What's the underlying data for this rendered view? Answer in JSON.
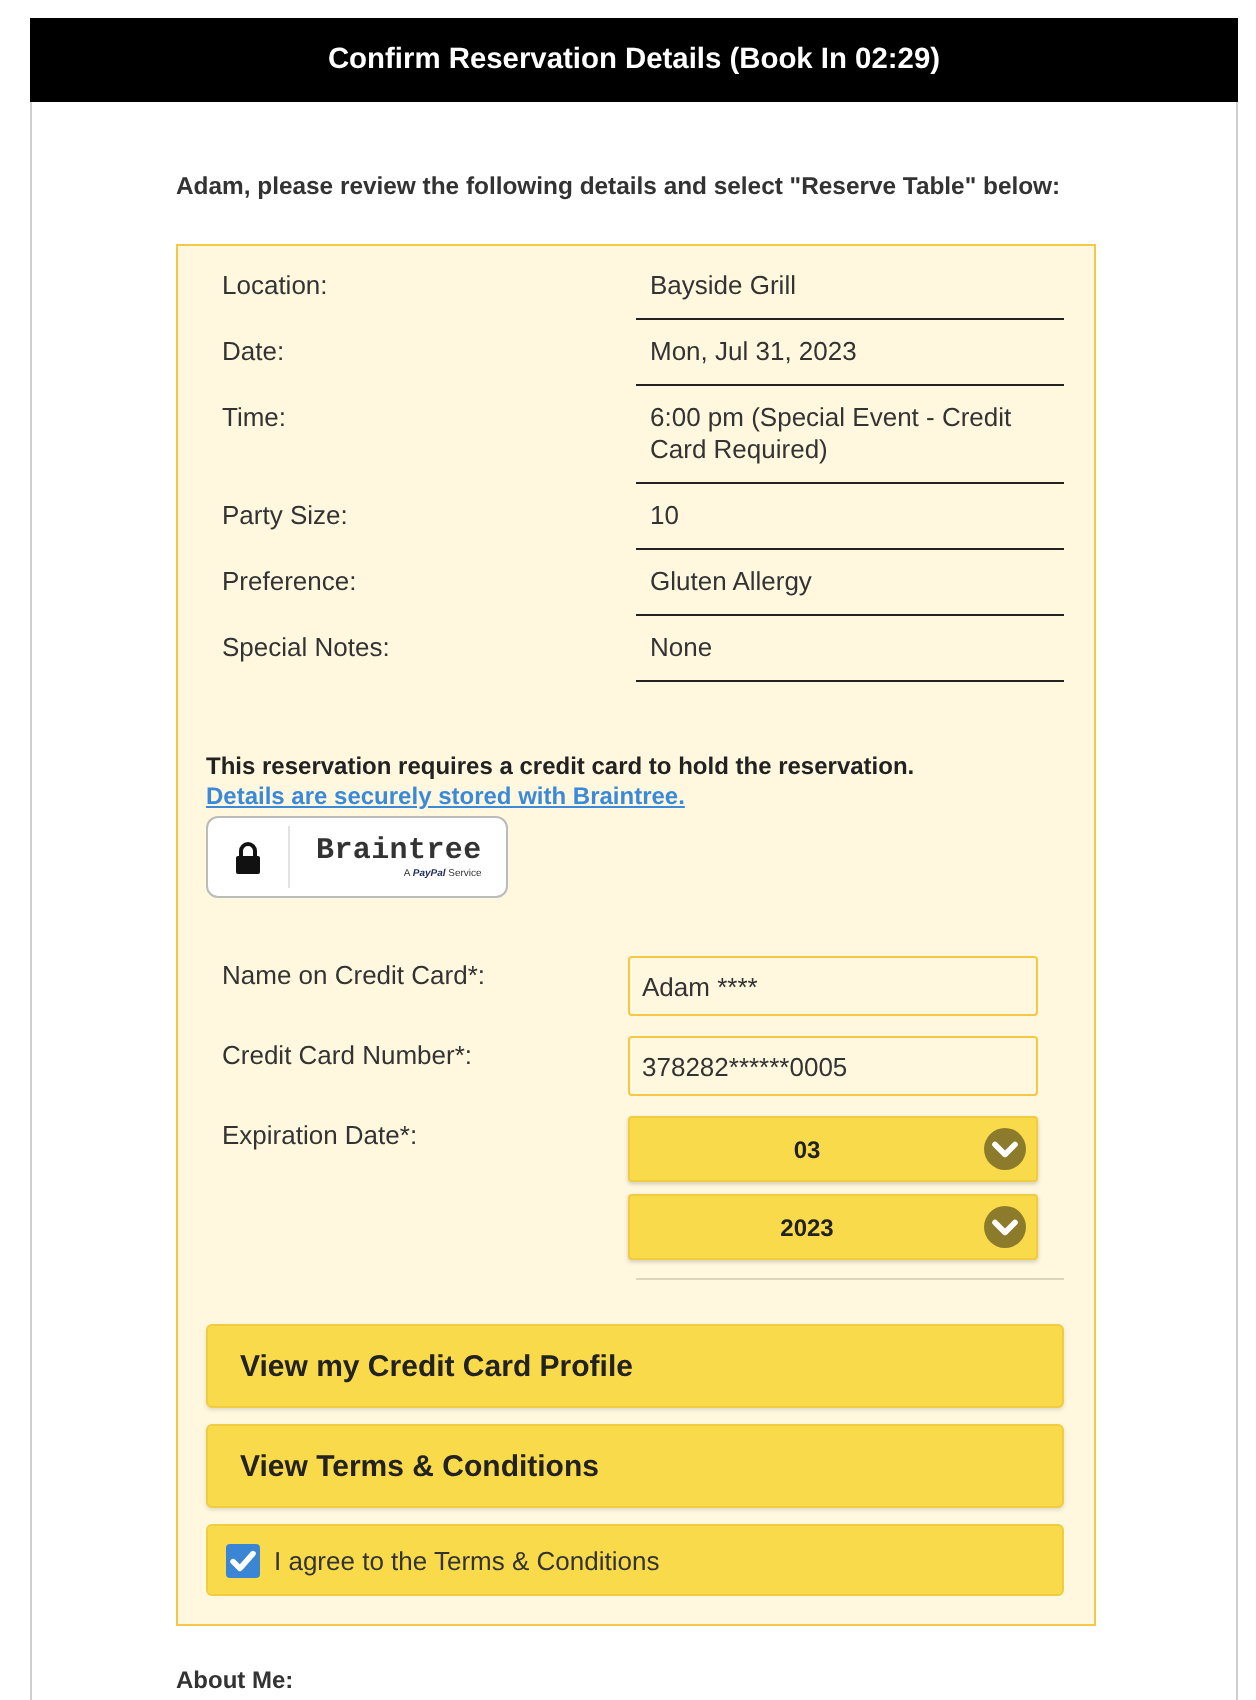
{
  "header": {
    "title": "Confirm Reservation Details (Book In 02:29)"
  },
  "intro": "Adam, please review the following details and select \"Reserve Table\" below:",
  "details": [
    {
      "label": "Location:",
      "value": "Bayside Grill"
    },
    {
      "label": "Date:",
      "value": "Mon, Jul 31, 2023"
    },
    {
      "label": "Time:",
      "value": "6:00 pm (Special Event - Credit Card Required)"
    },
    {
      "label": "Party Size:",
      "value": "10"
    },
    {
      "label": "Preference:",
      "value": "Gluten Allergy"
    },
    {
      "label": "Special Notes:",
      "value": "None"
    }
  ],
  "card_notice": {
    "text": "This reservation requires a credit card to hold the reservation.",
    "link": "Details are securely stored with Braintree."
  },
  "badge": {
    "brand": "Braintree",
    "tagline": "A **PayPal** Service"
  },
  "card_form": [
    {
      "kind": "text",
      "label": "Name on Credit Card*:",
      "value": "Adam ****"
    },
    {
      "kind": "text",
      "label": "Credit Card Number*:",
      "value": "378282******0005"
    },
    {
      "kind": "select",
      "label": "Expiration Date*:",
      "values": [
        "03",
        "2023"
      ]
    }
  ],
  "buttons": [
    "View my Credit Card Profile",
    "View Terms & Conditions"
  ],
  "agree": {
    "label": "I agree to the Terms & Conditions",
    "checked": true
  },
  "about": {
    "heading": "About Me:"
  }
}
